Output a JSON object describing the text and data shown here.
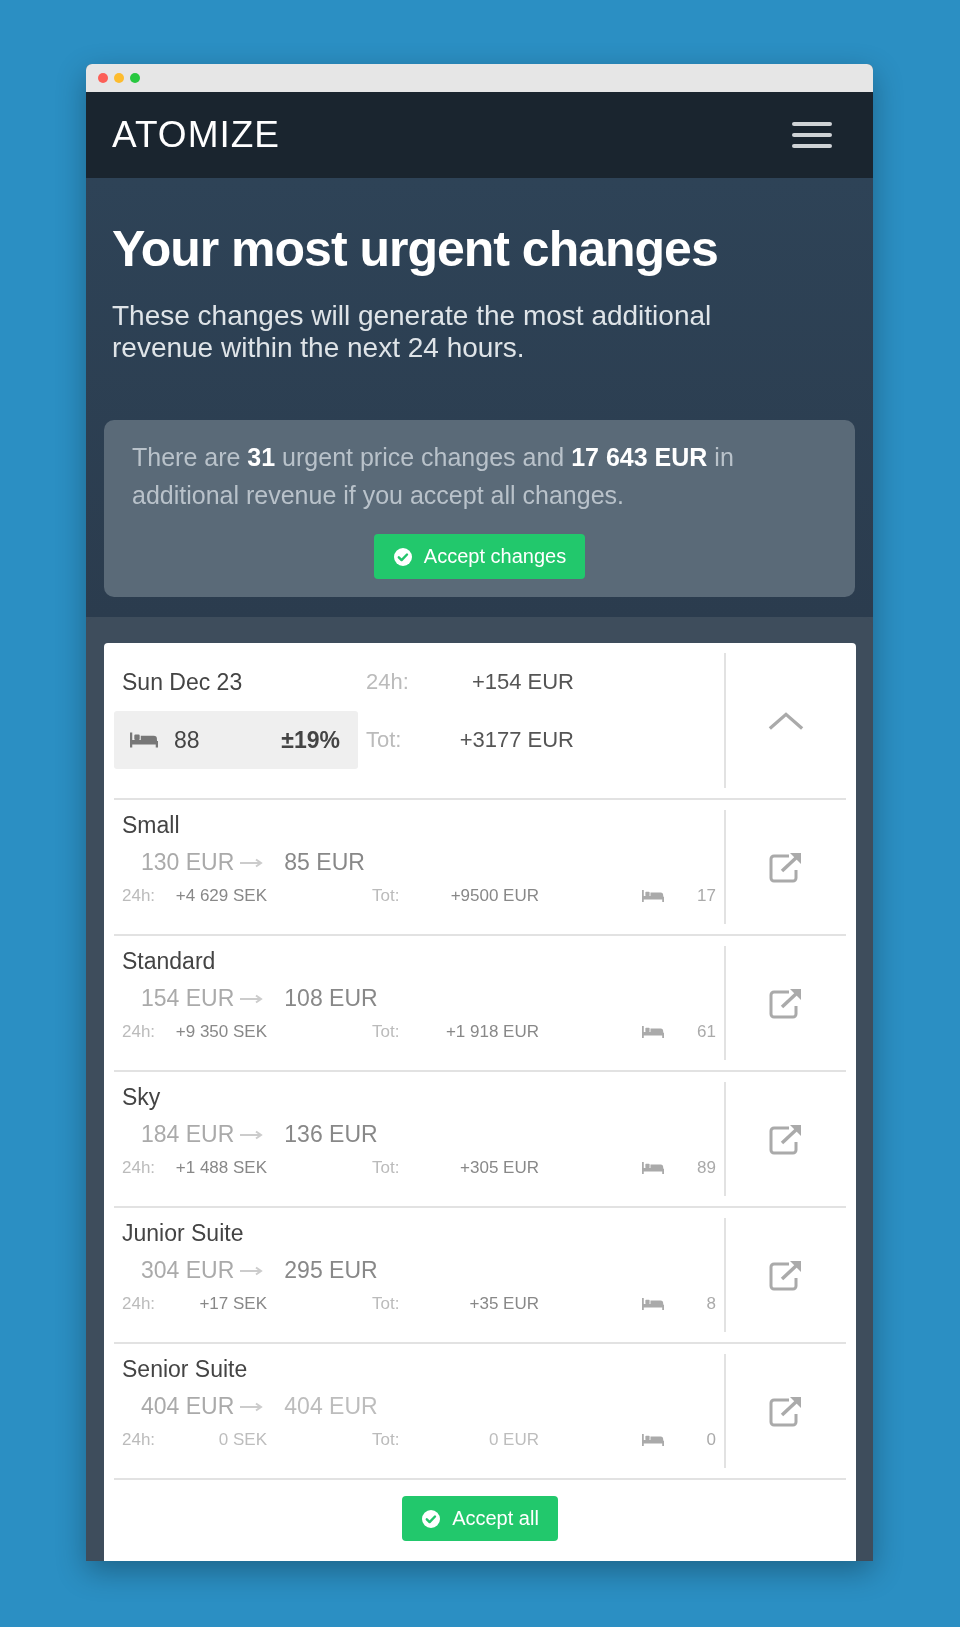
{
  "navbar": {
    "logo": "ATOMIZE"
  },
  "hero": {
    "title": "Your most urgent changes",
    "subtitle": "These changes will generate the most additional revenue within the next 24 hours."
  },
  "summary": {
    "text": "There are **31** urgent price changes and **17 643 EUR** in additional revenue if you accept all changes.",
    "button": "Accept changes"
  },
  "day": {
    "date": "Sun Dec 23",
    "rooms": "88",
    "change": "±19%",
    "label_24h": "24h:",
    "value_24h": "+154 EUR",
    "label_tot": "Tot:",
    "value_tot": "+3177 EUR",
    "expanded": true
  },
  "rooms": [
    {
      "name": "Small",
      "old_price": "130 EUR",
      "new_price": "85 EUR",
      "label_24h": "24h:",
      "value_24h": "+4 629 SEK",
      "label_tot": "Tot:",
      "value_tot": "+9500 EUR",
      "count": "17",
      "changed": true
    },
    {
      "name": "Standard",
      "old_price": "154 EUR",
      "new_price": "108 EUR",
      "label_24h": "24h:",
      "value_24h": "+9 350 SEK",
      "label_tot": "Tot:",
      "value_tot": "+1 918 EUR",
      "count": "61",
      "changed": true
    },
    {
      "name": "Sky",
      "old_price": "184 EUR",
      "new_price": "136 EUR",
      "label_24h": "24h:",
      "value_24h": "+1 488 SEK",
      "label_tot": "Tot:",
      "value_tot": "+305 EUR",
      "count": "89",
      "changed": true
    },
    {
      "name": "Junior Suite",
      "old_price": "304 EUR",
      "new_price": "295 EUR",
      "label_24h": "24h:",
      "value_24h": "+17 SEK",
      "label_tot": "Tot:",
      "value_tot": "+35 EUR",
      "count": "8",
      "changed": true
    },
    {
      "name": "Senior Suite",
      "old_price": "404 EUR",
      "new_price": "404 EUR",
      "label_24h": "24h:",
      "value_24h": "0 SEK",
      "label_tot": "Tot:",
      "value_tot": "0 EUR",
      "count": "0",
      "changed": false
    }
  ],
  "footer": {
    "button": "Accept all"
  }
}
